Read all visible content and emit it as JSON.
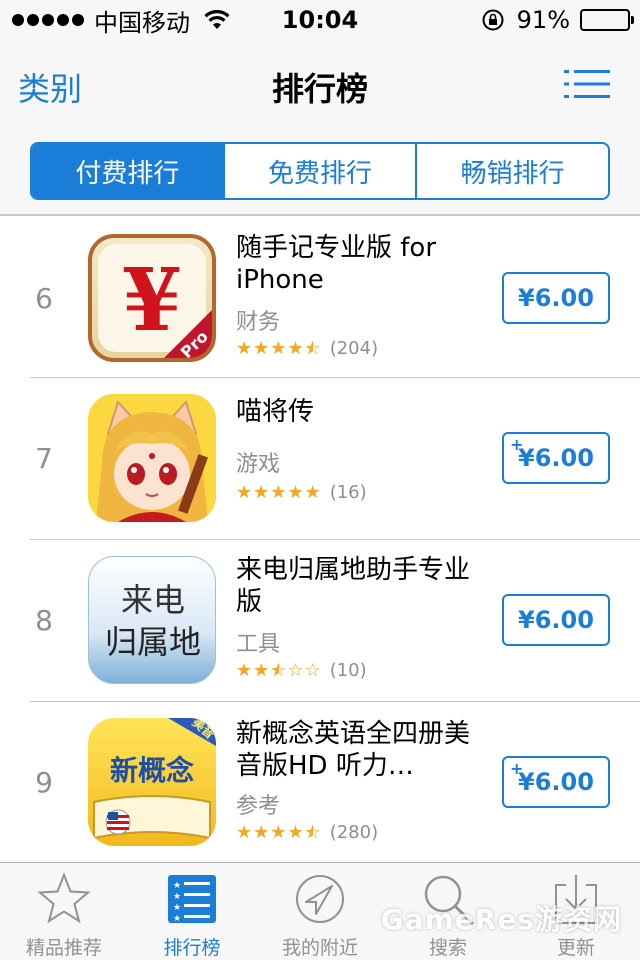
{
  "status_bar": {
    "carrier": "中国移动",
    "time": "10:04",
    "battery": "91%",
    "battery_level": 0.91
  },
  "nav": {
    "back_label": "类别",
    "title": "排行榜"
  },
  "segments": [
    {
      "label": "付费排行",
      "active": true
    },
    {
      "label": "免费排行",
      "active": false
    },
    {
      "label": "畅销排行",
      "active": false
    }
  ],
  "apps": [
    {
      "rank": "6",
      "name": "随手记专业版 for iPhone",
      "category": "财务",
      "stars": 4.5,
      "rating_count": "(204)",
      "price": "¥6.00",
      "has_plus": false,
      "icon_text": "¥",
      "icon_badge": "Pro"
    },
    {
      "rank": "7",
      "name": "喵将传",
      "category": "游戏",
      "stars": 5,
      "rating_count": "(16)",
      "price": "¥6.00",
      "has_plus": true
    },
    {
      "rank": "8",
      "name": "来电归属地助手专业版",
      "category": "工具",
      "stars": 2.5,
      "rating_count": "(10)",
      "price": "¥6.00",
      "has_plus": false,
      "icon_line1": "来电",
      "icon_line2": "归属地"
    },
    {
      "rank": "9",
      "name": "新概念英语全四册美音版HD 听力…",
      "category": "参考",
      "stars": 4.5,
      "rating_count": "(280)",
      "price": "¥6.00",
      "has_plus": true,
      "icon_text": "新概念",
      "icon_badge": "美音"
    }
  ],
  "tabs": [
    {
      "label": "精品推荐",
      "icon": "star-icon",
      "active": false
    },
    {
      "label": "排行榜",
      "icon": "ranking-list-icon",
      "active": true
    },
    {
      "label": "我的附近",
      "icon": "location-arrow-icon",
      "active": false
    },
    {
      "label": "搜索",
      "icon": "search-icon",
      "active": false
    },
    {
      "label": "更新",
      "icon": "download-tray-icon",
      "active": false
    }
  ],
  "watermark": "GameRes游资网",
  "colors": {
    "accent": "#1a7ed8",
    "star": "#f5a623",
    "muted": "#8e8e93"
  }
}
